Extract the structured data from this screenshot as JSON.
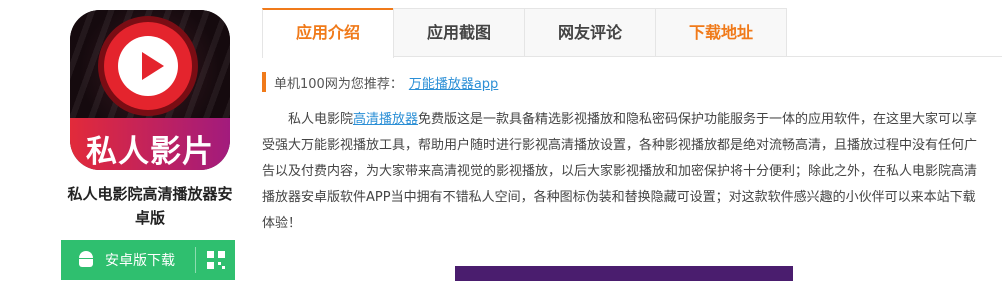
{
  "app": {
    "icon_text": "私人影片",
    "name_line1": "私人电影院高清播放器安",
    "name_line2": "卓版"
  },
  "download": {
    "android_label": "安卓版下载",
    "android_icon": "android-icon",
    "qr_icon": "qr-code-icon",
    "color": "#2fbf6f"
  },
  "tabs": [
    {
      "label": "应用介绍",
      "active": true
    },
    {
      "label": "应用截图",
      "active": false
    },
    {
      "label": "网友评论",
      "active": false
    },
    {
      "label": "下载地址",
      "active": false
    }
  ],
  "recommend": {
    "prefix": "单机100网为您推荐：",
    "link": "万能播放器app"
  },
  "description": {
    "part1": "私人电影院",
    "link": "高清播放器",
    "part2": "免费版这是一款具备精选影视播放和隐私密码保护功能服务于一体的应用软件，在这里大家可以享受强大万能影视播放工具，帮助用户随时进行影视高清播放设置，各种影视播放都是绝对流畅高清，且播放过程中没有任何广告以及付费内容，为大家带来高清视觉的影视播放，以后大家影视播放和加密保护将十分便利；除此之外，在私人电影院高清播放器安卓版软件APP当中拥有不错私人空间，各种图标伪装和替换隐藏可设置；对这款软件感兴趣的小伙伴可以来本站下载体验！"
  },
  "colors": {
    "accent": "#f07a1a",
    "link": "#2b8fd6"
  }
}
